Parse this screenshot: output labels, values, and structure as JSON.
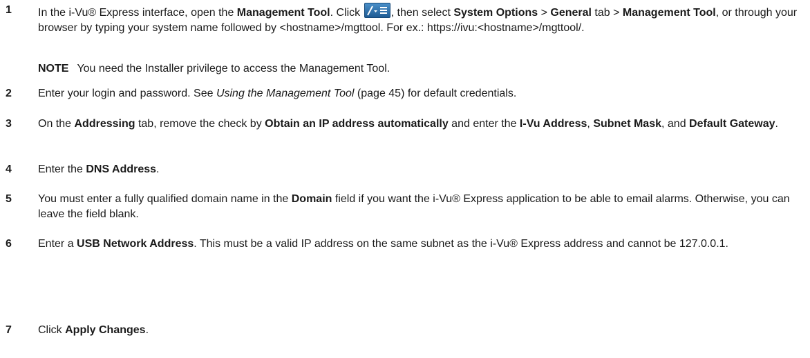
{
  "steps": [
    {
      "number": "1",
      "parts": [
        {
          "t": "In the i-Vu® Express interface, open the "
        },
        {
          "t": "Management Tool",
          "b": true
        },
        {
          "t": ". Click "
        },
        {
          "icon": "management-menu"
        },
        {
          "t": ", then select "
        },
        {
          "t": "System Options",
          "b": true
        },
        {
          "t": " > "
        },
        {
          "t": "General",
          "b": true
        },
        {
          "t": " tab > "
        },
        {
          "t": "Management Tool",
          "b": true
        },
        {
          "t": ", or through your browser by typing your system name followed by <hostname>/mgttool. For ex.: https://ivu:<hostname>/mgttool/."
        }
      ],
      "note": {
        "label": "NOTE",
        "text": "You need the Installer privilege to access the Management Tool."
      }
    },
    {
      "number": "2",
      "parts": [
        {
          "t": "Enter your login and password. See "
        },
        {
          "t": "Using the Management Tool",
          "i": true
        },
        {
          "t": " (page 45) for default credentials."
        }
      ]
    },
    {
      "number": "3",
      "parts": [
        {
          "t": "On the "
        },
        {
          "t": "Addressing",
          "b": true
        },
        {
          "t": " tab, remove the check by "
        },
        {
          "t": "Obtain an IP address automatically",
          "b": true
        },
        {
          "t": " and enter the "
        },
        {
          "t": "I-Vu Address",
          "b": true
        },
        {
          "t": ", "
        },
        {
          "t": "Subnet Mask",
          "b": true
        },
        {
          "t": ", and "
        },
        {
          "t": "Default Gateway",
          "b": true
        },
        {
          "t": "."
        }
      ]
    },
    {
      "number": "4",
      "parts": [
        {
          "t": "Enter the "
        },
        {
          "t": "DNS Address",
          "b": true
        },
        {
          "t": "."
        }
      ]
    },
    {
      "number": "5",
      "parts": [
        {
          "t": "You must enter a fully qualified domain name in the "
        },
        {
          "t": "Domain",
          "b": true
        },
        {
          "t": " field if you want the i-Vu® Express application to be able to email alarms. Otherwise, you can leave the field blank."
        }
      ]
    },
    {
      "number": "6",
      "parts": [
        {
          "t": "Enter a "
        },
        {
          "t": "USB Network Address",
          "b": true
        },
        {
          "t": ". This must be a valid IP address on the same subnet as the i-Vu® Express address and cannot be 127.0.0.1."
        }
      ]
    },
    {
      "number": "7",
      "parts": [
        {
          "t": "Click "
        },
        {
          "t": "Apply Changes",
          "b": true
        },
        {
          "t": "."
        }
      ]
    }
  ]
}
